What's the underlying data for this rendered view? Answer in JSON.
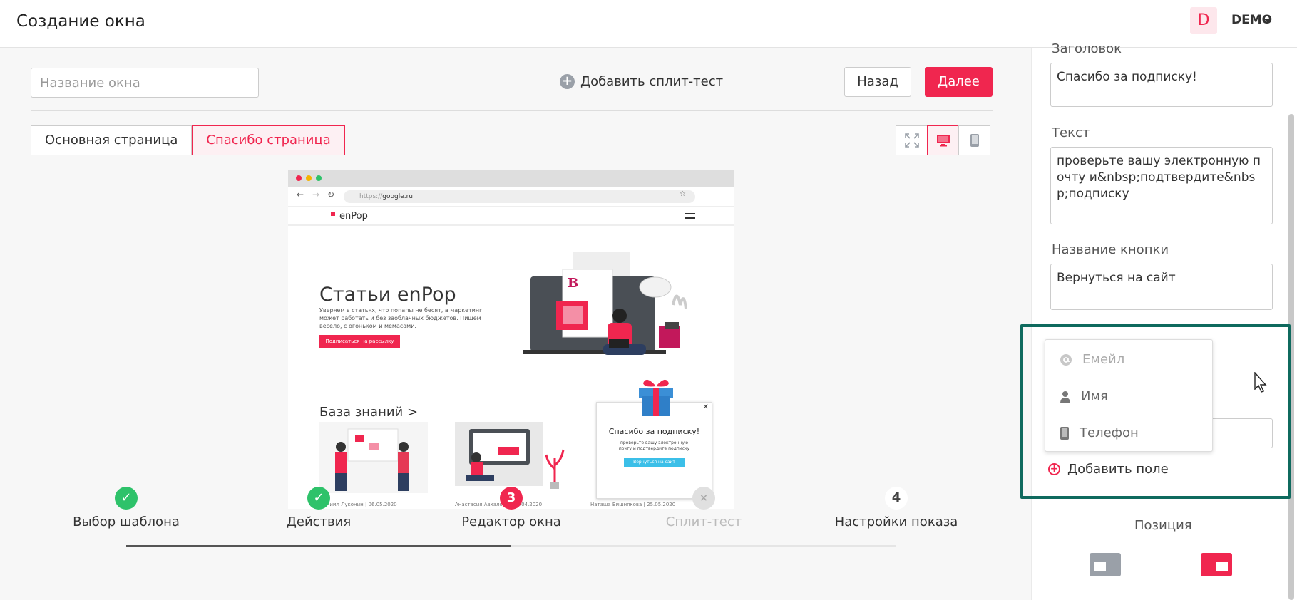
{
  "header": {
    "title": "Создание окна",
    "avatar_letter": "D",
    "user_name": "DEMO"
  },
  "toolbar": {
    "name_placeholder": "Название окна",
    "add_split_label": "Добавить сплит-тест",
    "back_label": "Назад",
    "next_label": "Далее"
  },
  "tabs": [
    {
      "label": "Основная страница",
      "active": false
    },
    {
      "label": "Спасибо страница",
      "active": true
    }
  ],
  "view_modes": [
    "fullscreen-icon",
    "desktop-icon",
    "mobile-icon"
  ],
  "preview": {
    "url_prefix": "https://",
    "url": "google.ru",
    "logo": "enPop",
    "hero_title": "Статьи enPop",
    "hero_desc": "Уверяем в статьях, что попапы не бесят, а маркетинг может работать и без заоблачных бюджетов. Пишем весело, с огоньком и мемасами.",
    "hero_button": "Подписаться на рассылку",
    "kb_title": "База знаний >",
    "cards": [
      "Даниил Луконин | 06.05.2020",
      "Анастасия Авхалова | 07.04.2020",
      "Наташа Вишнякова | 25.05.2020"
    ],
    "popup": {
      "title": "Спасибо за подписку!",
      "text": "проверьте вашу электронную почту и подтвердите подписку",
      "button": "Вернуться на сайт"
    }
  },
  "steps": [
    {
      "label": "Выбор шаблона",
      "state": "done"
    },
    {
      "label": "Действия",
      "state": "done"
    },
    {
      "label": "Редактор окна",
      "state": "current",
      "number": "3"
    },
    {
      "label": "Сплит-тест",
      "state": "disabled",
      "number": "×"
    },
    {
      "label": "Настройки показа",
      "state": "todo",
      "number": "4"
    }
  ],
  "sidebar": {
    "heading_label": "Заголовок",
    "heading_value": "Спасибо за подписку!",
    "text_label": "Текст",
    "text_value": "проверьте вашу электронную почту и&nbsp;подтвердите&nbsp;подписку",
    "button_label": "Название кнопки",
    "button_value": "Вернуться на сайт",
    "field_options": [
      {
        "label": "Емейл",
        "icon": "at-icon",
        "disabled": true
      },
      {
        "label": "Имя",
        "icon": "person-icon",
        "disabled": false
      },
      {
        "label": "Телефон",
        "icon": "phone-icon",
        "disabled": false
      }
    ],
    "add_field_label": "Добавить поле",
    "position_label": "Позиция"
  },
  "colors": {
    "accent": "#f0264f",
    "success": "#2ec26a",
    "highlight": "#0f6a5e"
  }
}
